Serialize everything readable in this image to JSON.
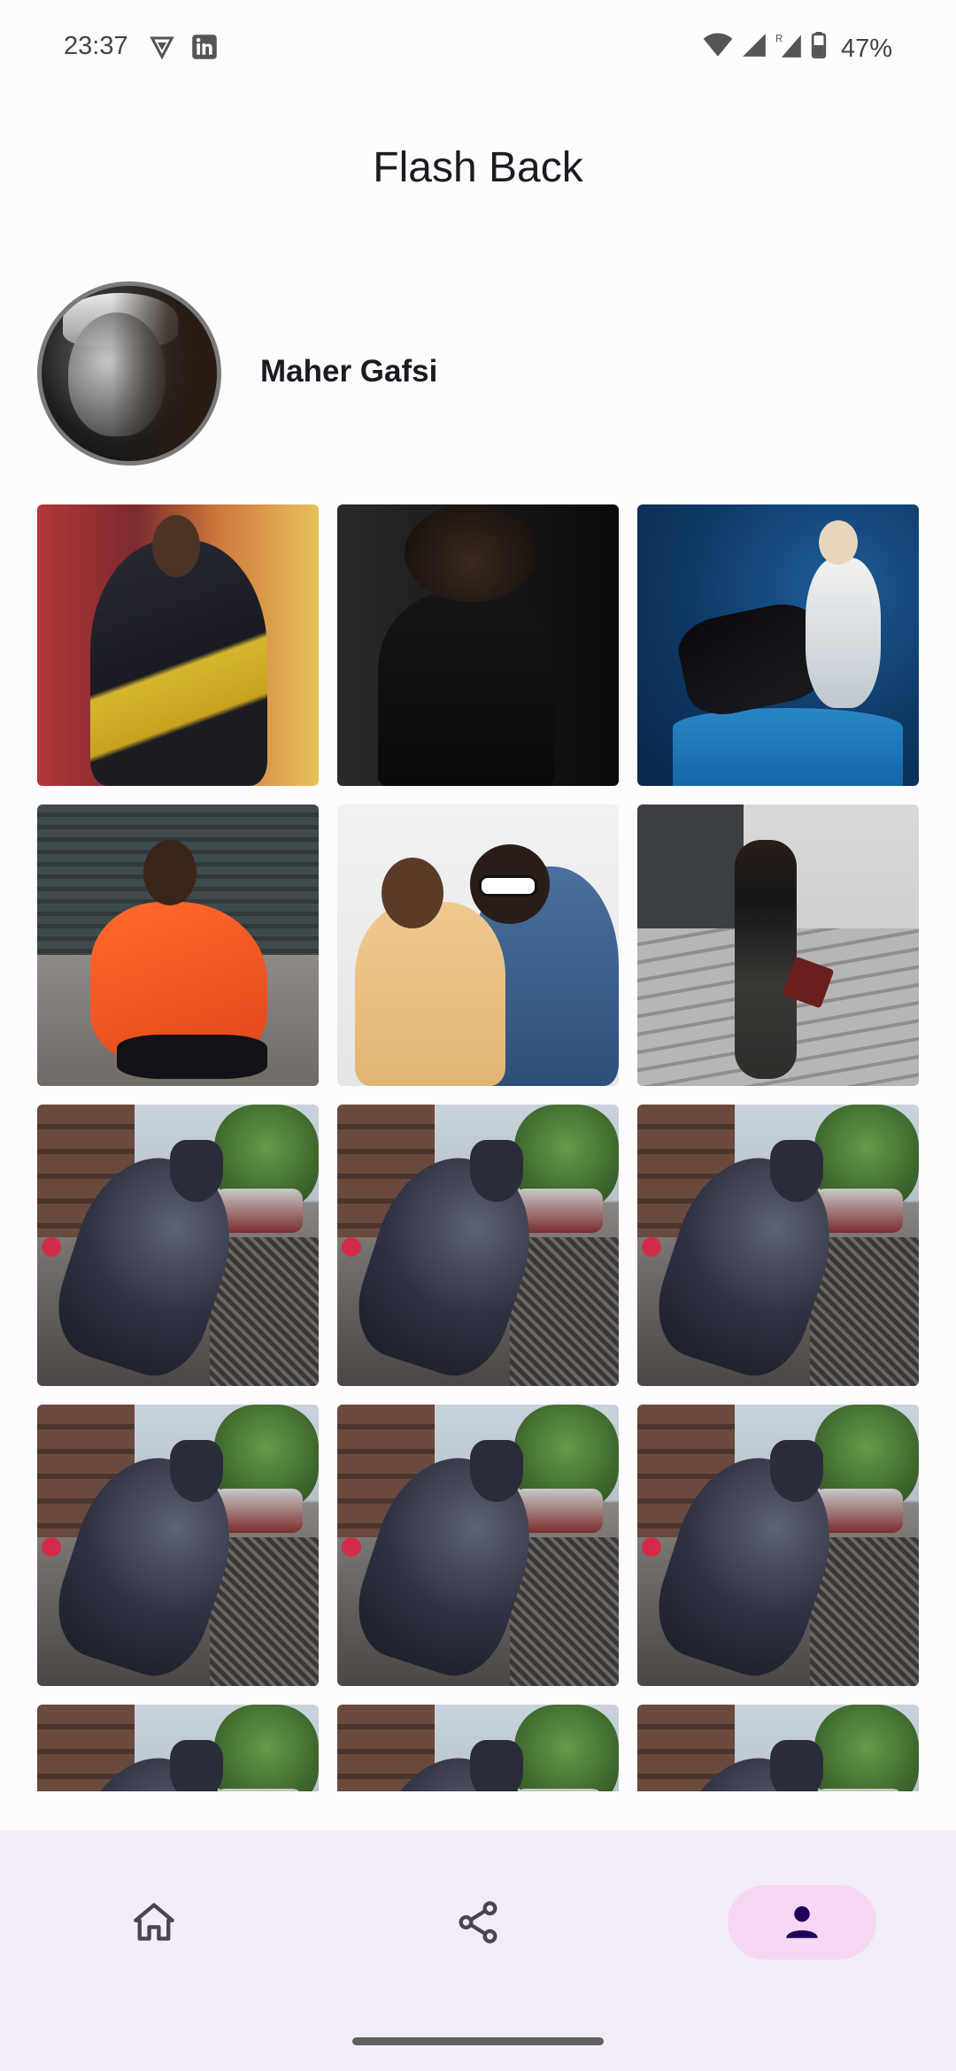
{
  "status_bar": {
    "time": "23:37",
    "battery_percent": "47%",
    "icons": [
      "vpn-shield-icon",
      "linkedin-icon",
      "wifi-icon",
      "cell-signal-icon",
      "roaming-signal-icon",
      "battery-icon"
    ]
  },
  "header": {
    "title": "Flash Back"
  },
  "profile": {
    "name": "Maher Gafsi",
    "avatar_icon": "profile-avatar"
  },
  "photos": {
    "count_visible_rows": 5,
    "items": [
      "street-portrait",
      "dark-portrait",
      "blue-studio-portrait",
      "orange-jacket-portrait",
      "two-friends-portrait",
      "stairs-portrait",
      "cat-statue",
      "cat-statue",
      "cat-statue",
      "cat-statue",
      "cat-statue",
      "cat-statue",
      "cat-statue",
      "cat-statue",
      "cat-statue"
    ]
  },
  "bottom_nav": {
    "items": [
      {
        "icon": "home-icon",
        "active": false
      },
      {
        "icon": "share-icon",
        "active": false
      },
      {
        "icon": "person-icon",
        "active": true
      }
    ],
    "active_color": "#f6d8f3",
    "background": "#f3edf7"
  }
}
